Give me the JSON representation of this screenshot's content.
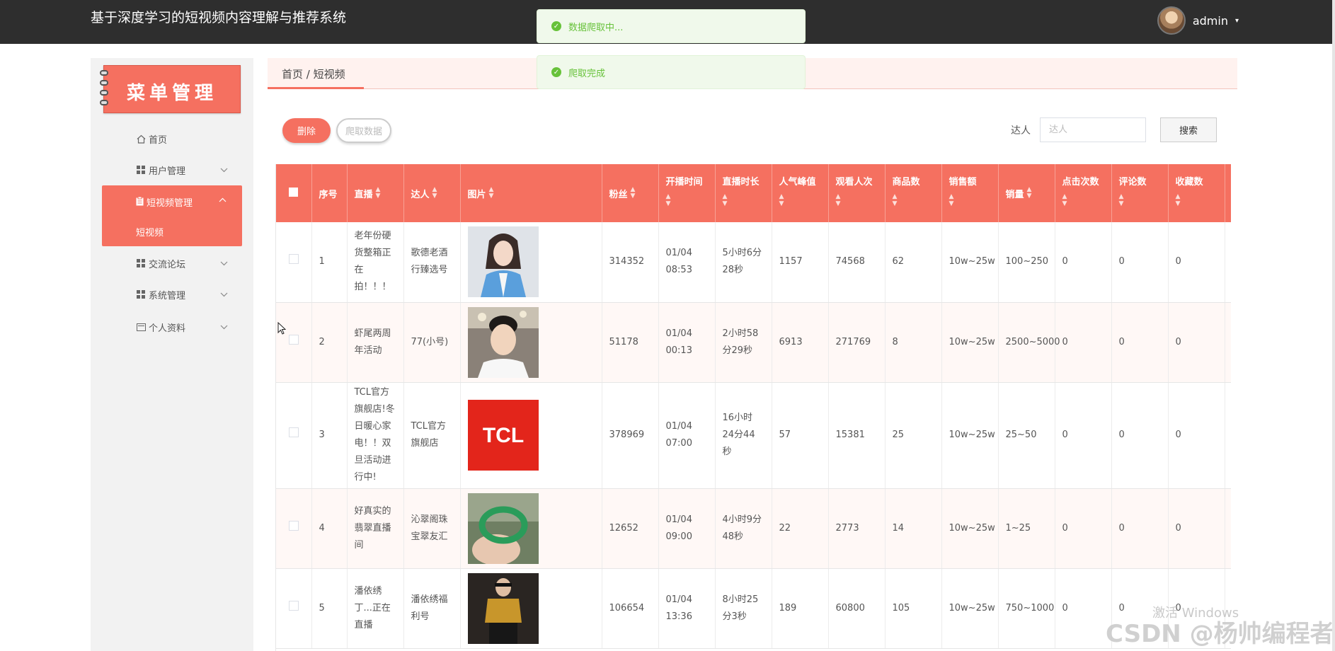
{
  "header": {
    "title": "基于深度学习的短视频内容理解与推荐系统",
    "user": "admin",
    "caret": "▾"
  },
  "toasts": [
    {
      "text": "数据爬取中..."
    },
    {
      "text": "爬取完成"
    }
  ],
  "sidebar": {
    "banner": "菜单管理",
    "items": [
      {
        "label": "首页"
      },
      {
        "label": "用户管理"
      },
      {
        "label": "短视频管理",
        "sub": "短视频"
      },
      {
        "label": "交流论坛"
      },
      {
        "label": "系统管理"
      },
      {
        "label": "个人资料"
      }
    ]
  },
  "breadcrumb": "首页 / 短视频",
  "actions": {
    "delete": "删除",
    "crawl": "爬取数据"
  },
  "search": {
    "label": "达人",
    "placeholder": "达人",
    "button": "搜索"
  },
  "table": {
    "headers": [
      "序号",
      "直播",
      "达人",
      "图片",
      "粉丝",
      "开播时间",
      "直播时长",
      "人气峰值",
      "观看人次",
      "商品数",
      "销售额",
      "销量",
      "点击次数",
      "评论数",
      "收藏数"
    ],
    "rows": [
      {
        "no": "1",
        "live": "老年份硬货整箱正在拍！！！",
        "talent": "歌德老酒行臻选号",
        "fans": "314352",
        "start": "01/04 08:53",
        "duration": "5小时6分28秒",
        "peak": "1157",
        "views": "74568",
        "goods": "62",
        "sales": "10w~25w",
        "volume": "100~250",
        "clicks": "0",
        "comments": "0",
        "favs": "0"
      },
      {
        "no": "2",
        "live": "虾尾两周年活动",
        "talent": "77(小号)",
        "fans": "51178",
        "start": "01/04 00:13",
        "duration": "2小时58分29秒",
        "peak": "6913",
        "views": "271769",
        "goods": "8",
        "sales": "10w~25w",
        "volume": "2500~5000",
        "clicks": "0",
        "comments": "0",
        "favs": "0"
      },
      {
        "no": "3",
        "live": "TCL官方旗舰店!冬日暖心家电！！双旦活动进行中!",
        "talent": "TCL官方旗舰店",
        "fans": "378969",
        "start": "01/04 07:00",
        "duration": "16小时24分44秒",
        "peak": "57",
        "views": "15381",
        "goods": "25",
        "sales": "10w~25w",
        "volume": "25~50",
        "clicks": "0",
        "comments": "0",
        "favs": "0",
        "logo": "TCL"
      },
      {
        "no": "4",
        "live": "好真实的翡翠直播间",
        "talent": "沁翠阁珠宝翠友汇",
        "fans": "12652",
        "start": "01/04 09:00",
        "duration": "4小时9分48秒",
        "peak": "22",
        "views": "2773",
        "goods": "14",
        "sales": "10w~25w",
        "volume": "1~25",
        "clicks": "0",
        "comments": "0",
        "favs": "0"
      },
      {
        "no": "5",
        "live": "潘依绣丁...正在直播",
        "talent": "潘依绣福利号",
        "fans": "106654",
        "start": "01/04 13:36",
        "duration": "8小时25分3秒",
        "peak": "189",
        "views": "60800",
        "goods": "105",
        "sales": "10w~25w",
        "volume": "750~1000",
        "clicks": "0",
        "comments": "0",
        "favs": "0"
      }
    ]
  },
  "watermarks": {
    "windows": "激活 Windows",
    "csdn": "CSDN @杨帅编程者"
  }
}
